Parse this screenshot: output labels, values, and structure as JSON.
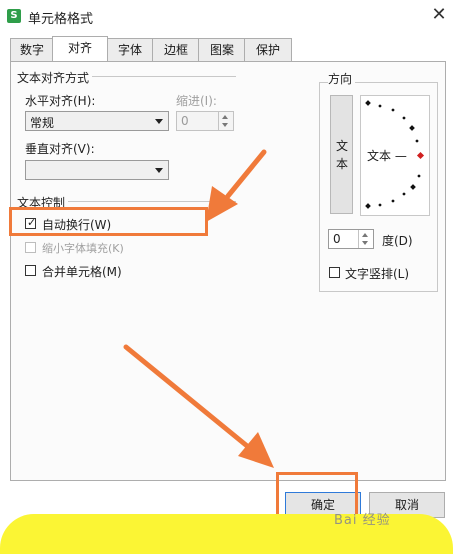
{
  "window": {
    "title": "单元格格式",
    "app_icon": "S",
    "close_glyph": "✕"
  },
  "tabs": [
    {
      "label": "数字",
      "active": false
    },
    {
      "label": "对齐",
      "active": true
    },
    {
      "label": "字体",
      "active": false
    },
    {
      "label": "边框",
      "active": false
    },
    {
      "label": "图案",
      "active": false
    },
    {
      "label": "保护",
      "active": false
    }
  ],
  "alignment": {
    "section_title": "文本对齐方式",
    "horizontal": {
      "label": "水平对齐(H):",
      "value": "常规"
    },
    "indent": {
      "label": "缩进(I):",
      "value": "0"
    },
    "vertical": {
      "label": "垂直对齐(V):",
      "value": ""
    }
  },
  "text_control": {
    "section_title": "文本控制",
    "wrap_text": {
      "label": "自动换行(W)",
      "checked": true
    },
    "shrink_to_fit": {
      "label": "缩小字体填充(K)",
      "checked": false,
      "disabled": true
    },
    "merge_cells": {
      "label": "合并单元格(M)",
      "checked": false
    }
  },
  "orientation": {
    "section_title": "方向",
    "vertical_text": [
      "文",
      "本"
    ],
    "dial_label": "文本 —",
    "degree_value": "0",
    "degree_label": "度(D)",
    "vertical_stack": {
      "label": "文字竖排(L)",
      "checked": false
    }
  },
  "buttons": {
    "ok": "确定",
    "cancel": "取消"
  },
  "watermark": "Bai 经验",
  "colors": {
    "annotation": "#f07a3a",
    "highlight_band": "#fbf534",
    "dial_accent": "#d02020"
  }
}
